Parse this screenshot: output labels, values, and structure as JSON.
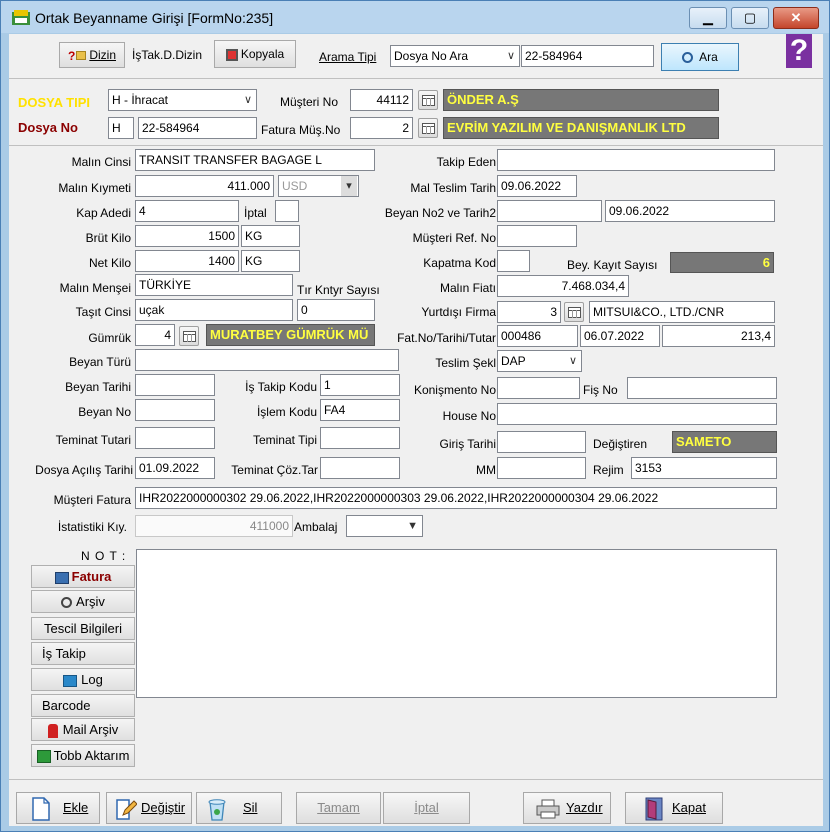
{
  "window": {
    "title": "Ortak Beyanname Girişi [FormNo:235]",
    "minimize": "▁",
    "maximize": "▢",
    "close": "✕"
  },
  "toolbar": {
    "dizin_label": "Dizin",
    "istak_label": "İşTak.D.Dizin",
    "kopyala_label": "Kopyala",
    "arama_tipi_label": "Arama Tipi",
    "arama_tipi_value": "Dosya No Ara",
    "search_value": "22-584964",
    "ara_label": "Ara",
    "help_glyph": "?"
  },
  "header": {
    "dosya_tipi_label": "DOSYA TIPI",
    "dosya_tipi_value": "H - İhracat",
    "musteri_no_label": "Müşteri No",
    "musteri_no_value": "44112",
    "musteri_name": "ÖNDER A.Ş",
    "dosya_no_label": "Dosya No",
    "dosya_no_prefix": "H",
    "dosya_no_value": "22-584964",
    "fatura_mus_no_label": "Fatura Müş.No",
    "fatura_mus_no_value": "2",
    "fatura_mus_name": "EVRİM YAZILIM VE DANIŞMANLIK LTD"
  },
  "form": {
    "malin_cinsi_label": "Malın Cinsi",
    "malin_cinsi_value": "TRANSIT TRANSFER BAGAGE L",
    "takip_eden_label": "Takip Eden",
    "takip_eden_value": "",
    "malin_kiymeti_label": "Malın Kıymeti",
    "malin_kiymeti_value": "411.000",
    "currency_value": "USD",
    "mal_teslim_label": "Mal Teslim Tarih",
    "mal_teslim_value": "09.06.2022",
    "kap_adedi_label": "Kap Adedi",
    "kap_adedi_value": "4",
    "iptal_label": "İptal",
    "beyan_no2_label": "Beyan  No2 ve Tarih2",
    "beyan_no2_value": "",
    "beyan_tarih2_value": "09.06.2022",
    "brut_kilo_label": "Brüt Kilo",
    "brut_kilo_value": "1500",
    "brut_unit": "KG",
    "musteri_ref_label": "Müşteri  Ref. No",
    "musteri_ref_value": "",
    "net_kilo_label": "Net Kilo",
    "net_kilo_value": "1400",
    "net_unit": "KG",
    "kapatma_kod_label": "Kapatma Kod",
    "kapatma_kod_value": "",
    "bey_kayit_label": "Bey. Kayıt Sayısı",
    "bey_kayit_value": "6",
    "malin_mensei_label": "Malın Menşei",
    "malin_mensei_value": "TÜRKİYE",
    "tir_label": "Tır Kntyr Sayısı",
    "tir_value": "0",
    "malin_fiati_label": "Malın Fiatı",
    "malin_fiati_value": "7.468.034,4",
    "tasit_cinsi_label": "Taşıt Cinsi",
    "tasit_cinsi_value": "uçak",
    "yurtdisi_label": "Yurtdışı Firma",
    "yurtdisi_no": "3",
    "yurtdisi_name": "MITSUI&CO., LTD./CNR",
    "gumruk_label": "Gümrük",
    "gumruk_no": "4",
    "gumruk_name": "MURATBEY GÜMRÜK MÜ",
    "fat_no_label": "Fat.No/Tarihi/Tutar",
    "fat_no_value": "000486",
    "fat_tarih_value": "06.07.2022",
    "fat_tutar_value": "213,4",
    "beyan_turu_label": "Beyan Türü",
    "beyan_turu_value": "",
    "teslim_sekli_label": "Teslim Şekl",
    "teslim_sekli_value": "DAP",
    "beyan_tarihi_label": "Beyan Tarihi",
    "beyan_tarihi_value": "",
    "is_takip_kodu_label": "İş Takip Kodu",
    "is_takip_kodu_value": "1",
    "konismento_label": "Konişmento No",
    "konismento_value": "",
    "fis_no_label": "Fiş No",
    "fis_no_value": "",
    "beyan_no_label": "Beyan No",
    "beyan_no_value": "",
    "islem_kodu_label": "İşlem Kodu",
    "islem_kodu_value": "FA4",
    "house_no_label": "House No",
    "house_no_value": "",
    "teminat_tutari_label": "Teminat Tutari",
    "teminat_tutari_value": "",
    "teminat_tipi_label": "Teminat Tipi",
    "teminat_tipi_value": "",
    "giris_tarihi_label": "Giriş Tarihi",
    "giris_tarihi_value": "",
    "degistiren_label": "Değiştiren",
    "degistiren_value": "SAMETO",
    "dosya_acilis_label": "Dosya Açılış Tarihi",
    "dosya_acilis_value": "01.09.2022",
    "teminat_coz_label": "Teminat Çöz.Tar",
    "teminat_coz_value": "",
    "mm_label": "MM",
    "mm_value": "",
    "rejim_label": "Rejim",
    "rejim_value": "3153",
    "musteri_fatura_label": "Müşteri Fatura",
    "musteri_fatura_value": "IHR2022000000302 29.06.2022,IHR2022000000303 29.06.2022,IHR2022000000304 29.06.2022",
    "istatistiki_label": "İstatistiki Kıy.",
    "istatistiki_value": "411000",
    "ambalaj_label": "Ambalaj",
    "ambalaj_value": "",
    "not_label": "N O T :"
  },
  "side_buttons": {
    "fatura": "Fatura",
    "arsiv": "Arşiv",
    "tescil": "Tescil Bilgileri",
    "is_takip": "İş Takip",
    "log": "Log",
    "barcode": "Barcode",
    "mail_arsiv": "Mail Arşiv",
    "tobb": "Tobb Aktarım"
  },
  "bottom_buttons": {
    "ekle": "Ekle",
    "degistir": "Değiştir",
    "sil": "Sil",
    "tamam": "Tamam",
    "iptal": "İptal",
    "yazdir": "Yazdır",
    "kapat": "Kapat"
  }
}
